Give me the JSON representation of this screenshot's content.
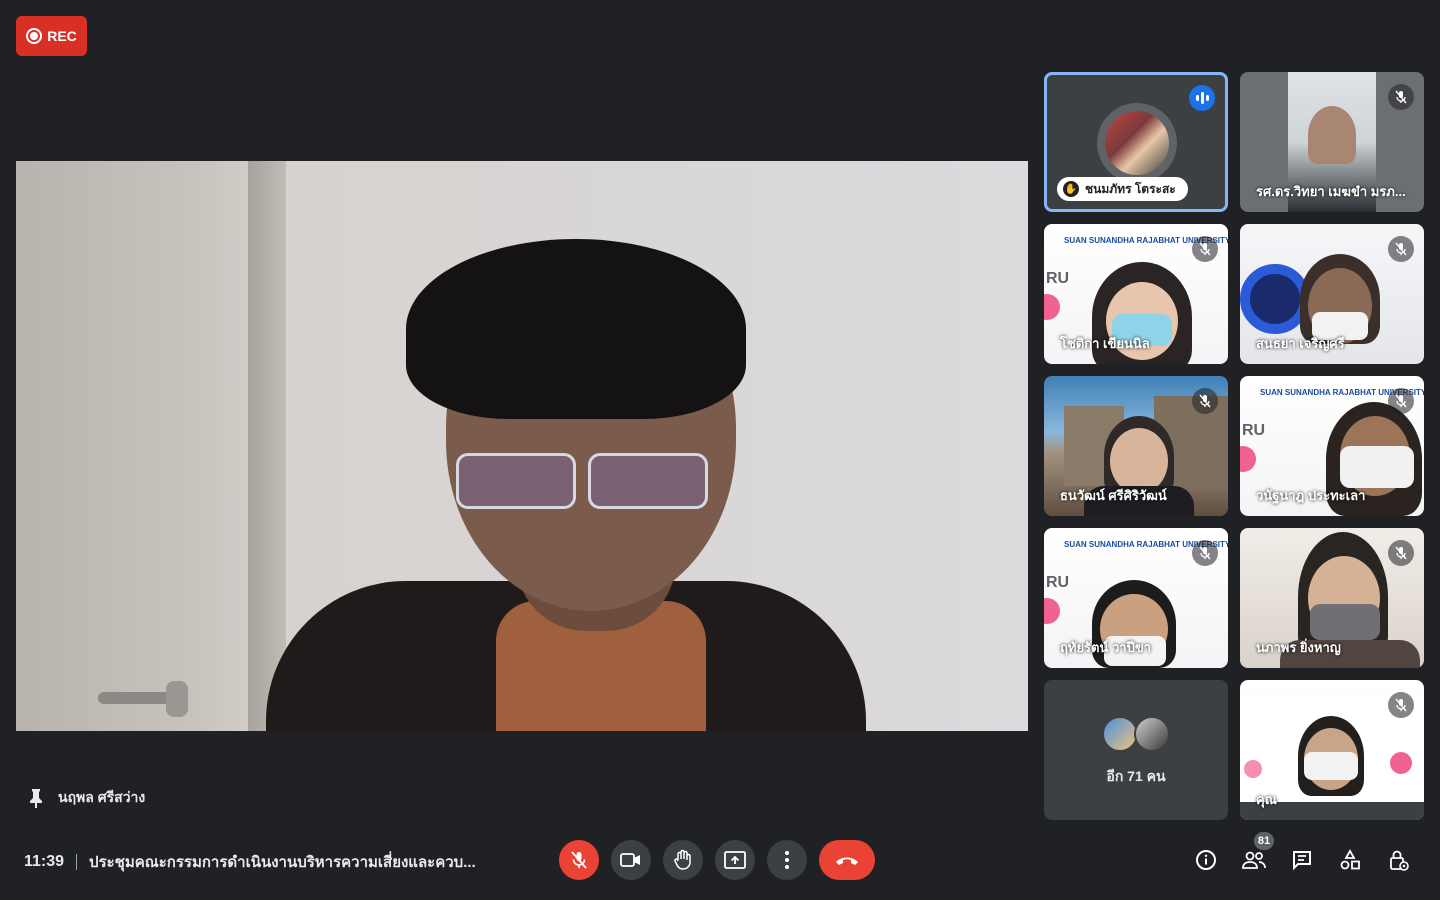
{
  "recording": {
    "label": "REC"
  },
  "pinned": {
    "name": "นฤพล ศรีสว่าง"
  },
  "tiles": [
    {
      "name": "ชนมภัทร โตระสะ",
      "hand_raised": true,
      "speaking": true
    },
    {
      "name": "รศ.ดร.วิทยา เมฆขำ มรภ...",
      "muted": true
    },
    {
      "name": "โชติกา เขียนนิล",
      "muted": true
    },
    {
      "name": "สนธยา เจริญศรี",
      "muted": true
    },
    {
      "name": "ธนวัฒน์ ศรีศิริวัฒน์",
      "muted": true
    },
    {
      "name": "วนัฐนาฎ ประทะเลา",
      "muted": true
    },
    {
      "name": "ฤทัยรัตน์ วาปีขา",
      "muted": true
    },
    {
      "name": "นภาพร ยิ่งหาญ",
      "muted": true
    },
    {
      "name": "คุณ",
      "muted": true
    }
  ],
  "brand_text": "SUAN SUNANDHA RAJABHAT UNIVERSITY",
  "ru_text": "RU",
  "more": {
    "label": "อีก 71 คน"
  },
  "bottom": {
    "time": "11:39",
    "meeting_title": "ประชุมคณะกรรมการดำเนินงานบริหารความเสี่ยงและควบ..."
  },
  "participants_count": "81",
  "icons": {
    "mic_off": "mic-off-icon",
    "camera": "videocam-icon",
    "hand": "raise-hand-icon",
    "present": "present-screen-icon",
    "more": "more-vert-icon",
    "end_call": "call-end-icon",
    "info": "info-icon",
    "people": "people-icon",
    "chat": "chat-icon",
    "activities": "activities-icon",
    "host": "host-controls-icon"
  },
  "colors": {
    "background": "#202124",
    "tile": "#3c4043",
    "danger": "#ea4335",
    "accent": "#1a73e8",
    "active_border": "#8ab4f8"
  }
}
